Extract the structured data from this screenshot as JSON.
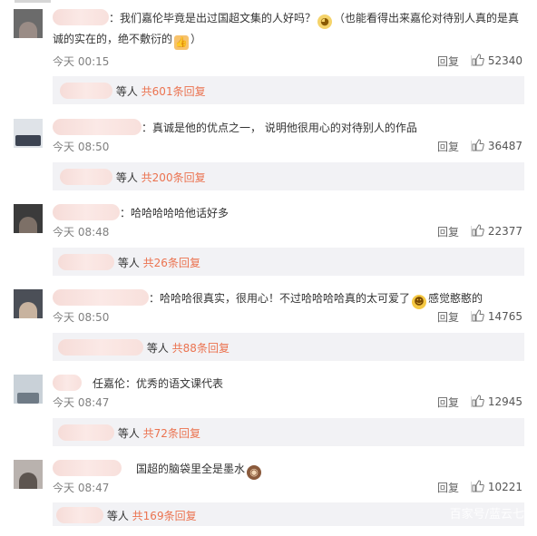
{
  "comments": [
    {
      "text": "我们嘉伦毕竟是出过国超文集的人好吗？",
      "text2": "（也能看得出来嘉伦对待别人真的是真",
      "text_line2": "诚的实在的，绝不敷衍的",
      "time": "今天 00:15",
      "reply": "回复",
      "likes": "52340",
      "sub_suffix": "等人",
      "sub_count": "共601条回复"
    },
    {
      "text": "真诚是他的优点之一， 说明他很用心的对待别人的作品",
      "time": "今天 08:50",
      "reply": "回复",
      "likes": "36487",
      "sub_suffix": "等人",
      "sub_count": "共200条回复"
    },
    {
      "text": "哈哈哈哈哈他话好多",
      "time": "今天 08:48",
      "reply": "回复",
      "likes": "22377",
      "sub_suffix": "等人",
      "sub_count": "共26条回复"
    },
    {
      "text": "哈哈哈很真实，很用心！不过哈哈哈哈真的太可爱了",
      "text2": "感觉憨憨的",
      "time": "今天 08:50",
      "reply": "回复",
      "likes": "14765",
      "sub_suffix": "等人",
      "sub_count": "共88条回复"
    },
    {
      "text": "任嘉伦：优秀的语文课代表",
      "time": "今天 08:47",
      "reply": "回复",
      "likes": "12945",
      "sub_suffix": "等人",
      "sub_count": "共72条回复"
    },
    {
      "text": "国超的脑袋里全是墨水",
      "time": "今天 08:47",
      "reply": "回复",
      "likes": "10221",
      "sub_suffix": "等人",
      "sub_count": "共169条回复"
    }
  ],
  "watermark": "百家号/蓝云七",
  "colors": {
    "accent": "#eb7350",
    "subbar_bg": "#f2f2f5",
    "meta_text": "#808080"
  },
  "icons": {
    "like": "thumbs-up-icon",
    "emoji_dog": "dog-emoji-icon",
    "emoji_thumb": "thumbs-up-emoji-icon",
    "emoji_laugh": "laughing-emoji-icon",
    "emoji_monkey": "monkey-emoji-icon"
  }
}
